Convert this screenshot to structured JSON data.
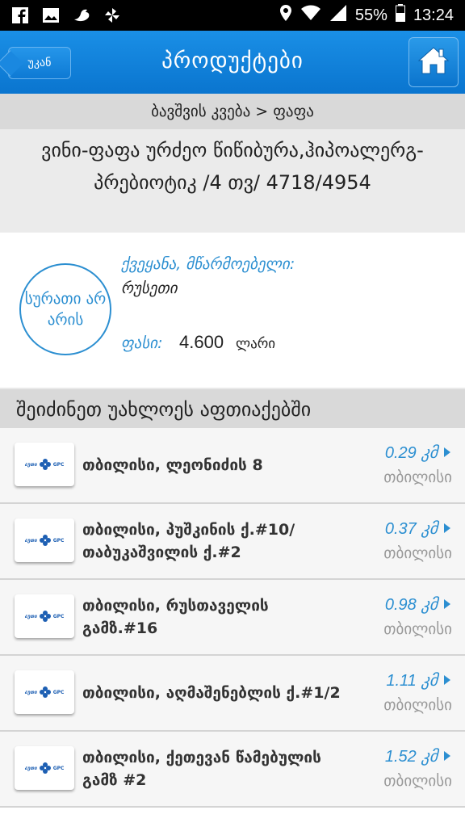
{
  "status_bar": {
    "battery": "55%",
    "time": "13:24"
  },
  "app_bar": {
    "back_label": "უკან",
    "title": "პროდუქტები"
  },
  "breadcrumb": "ბავშვის კვება > ფაფა",
  "product": {
    "title": "ვინი-ფაფა ურძეო წიწიბურა,ჰიპოალერგ-პრებიოტიკ /4 თვ/ 4718/4954",
    "no_image_text": "სურათი არ არის",
    "country_label": "ქვეყანა, მწარმოებელი:",
    "country_value": "რუსეთი",
    "price_label": "ფასი:",
    "price_value": "4.600",
    "currency": "ლარი"
  },
  "section_header": "შეიძინეთ უახლოეს აფთიაქებში",
  "pharmacies": [
    {
      "address": "თბილისი, ლეონიძის 8",
      "distance": "0.29 კმ",
      "city": "თბილისი"
    },
    {
      "address": "თბილისი, პუშკინის ქ.#10/ თაბუკაშვილის ქ.#2",
      "distance": "0.37 კმ",
      "city": "თბილისი"
    },
    {
      "address": "თბილისი, რუსთაველის გამზ.#16",
      "distance": "0.98 კმ",
      "city": "თბილისი"
    },
    {
      "address": "თბილისი, აღმაშენებლის ქ.#1/2",
      "distance": "1.11 კმ",
      "city": "თბილისი"
    },
    {
      "address": "თბილისი, ქეთევან წამებულის გამზ #2",
      "distance": "1.52 კმ",
      "city": "თბილისი"
    }
  ],
  "logo": {
    "left_text": "აუთი",
    "right_text": "GPC"
  },
  "colors": {
    "accent": "#2c8fd1",
    "appbar": "#0a75cf"
  },
  "icons": [
    "facebook-icon",
    "gallery-icon",
    "bird-icon",
    "pinwheel-icon",
    "location-icon",
    "wifi-icon",
    "signal-icon",
    "battery-icon",
    "home-icon",
    "chevron-right-icon"
  ]
}
